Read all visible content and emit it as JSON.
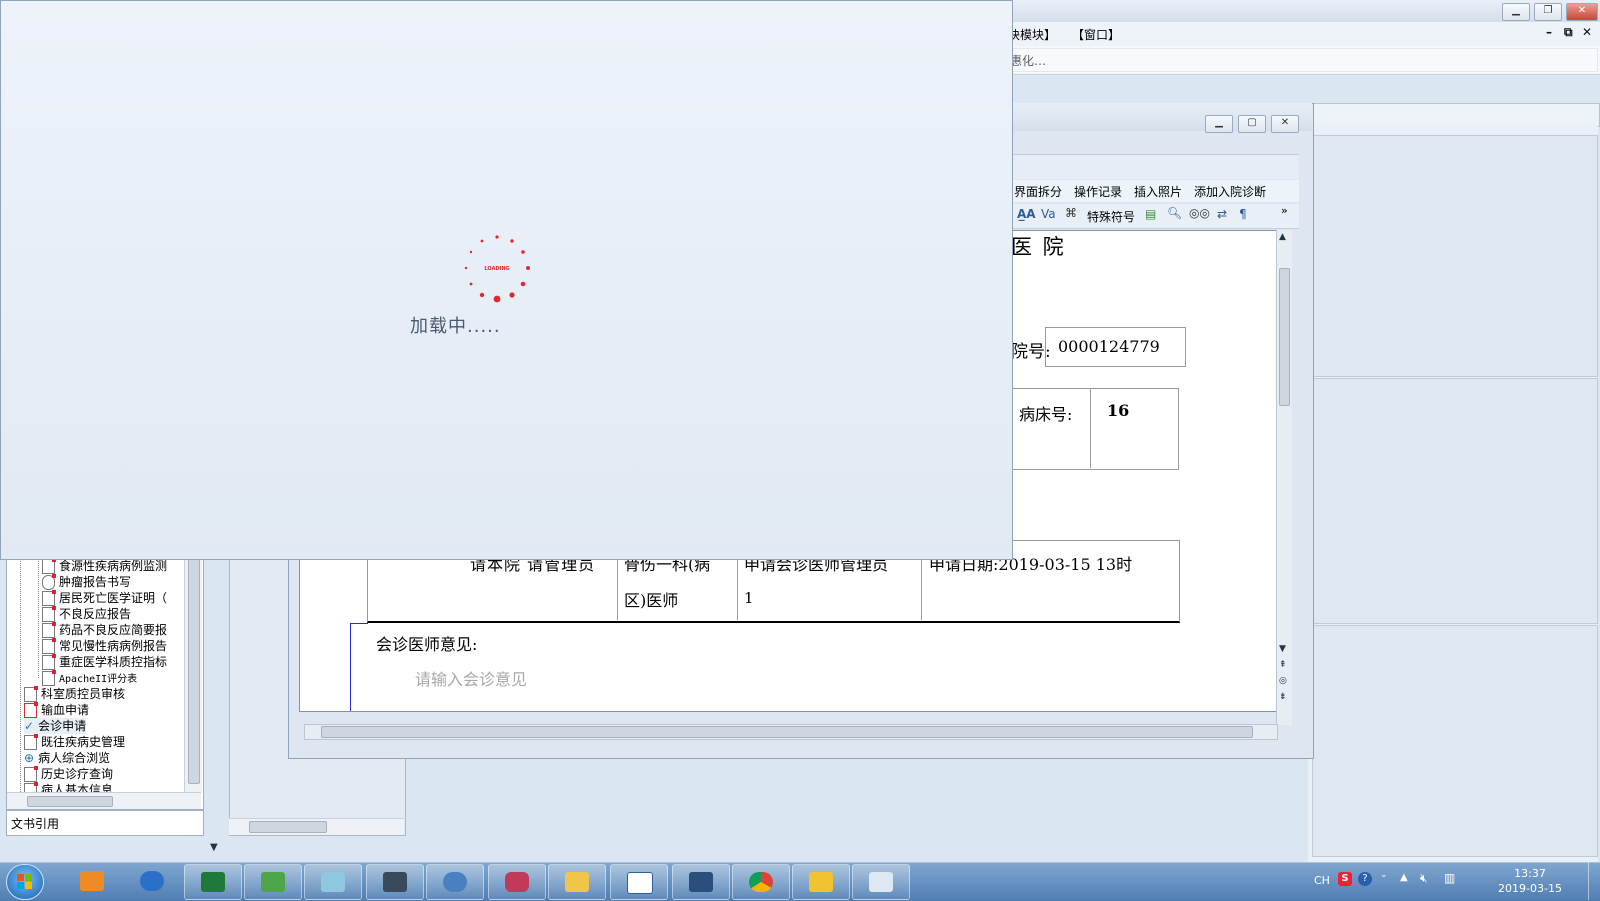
{
  "main_menu": {
    "module_suffix": "块模块】",
    "window": "【窗口】"
  },
  "main_toolbar": {
    "text": "惠化…"
  },
  "mdi_controls": {
    "minimize": "–",
    "restore": "⧉",
    "close": "✕"
  },
  "left_tree": {
    "items": [
      "食源性疾病病例监测",
      "肿瘤报告书写",
      "居民死亡医学证明（",
      "不良反应报告",
      "药品不良反应简要报",
      "常见慢性病病例报告",
      "重症医学科质控指标",
      "ApacheII评分表",
      "科室质控员审核",
      "输血申请",
      "会诊申请",
      "既往疾病史管理",
      "病人综合浏览",
      "历史诊疗查询",
      "病人基本信息"
    ],
    "bottom_label": "文书引用"
  },
  "doc_window": {
    "menu": [
      "界面拆分",
      "操作记录",
      "插入照片",
      "添加入院诊断"
    ],
    "toolbar_special": "特殊符号"
  },
  "document": {
    "hospital_title": "医 院",
    "admission_label": "院号:",
    "admission_no": "0000124779",
    "bed_label": "病床号:",
    "bed_no": "16",
    "request_text": "请本院  请管理员",
    "dept_line1": "骨伤一科(病",
    "dept_line2": "区)医师",
    "doctor_line1": "申请会诊医师管理员",
    "doctor_line2": "1",
    "request_date": "申请日期:2019-03-15 13时",
    "opinion_label": "会诊医师意见:",
    "opinion_placeholder": "请输入会诊意见"
  },
  "loading": {
    "spinner_text": "LOADING",
    "text": "加载中....."
  },
  "taskbar": {
    "lang": "CH",
    "time": "13:37",
    "date": "2019-03-15",
    "apps": [
      "media-player-icon",
      "tools-icon",
      "excel-icon",
      "sync-icon",
      "notes-icon",
      "monitor-icon",
      "dolphin-icon",
      "database-icon",
      "folder-icon",
      "clipboard-icon",
      "chart-icon",
      "chrome-icon",
      "sql-icon",
      "doctor-icon"
    ]
  },
  "colors": {
    "accent": "#e0282e",
    "taskbar": "#5a86b8"
  }
}
